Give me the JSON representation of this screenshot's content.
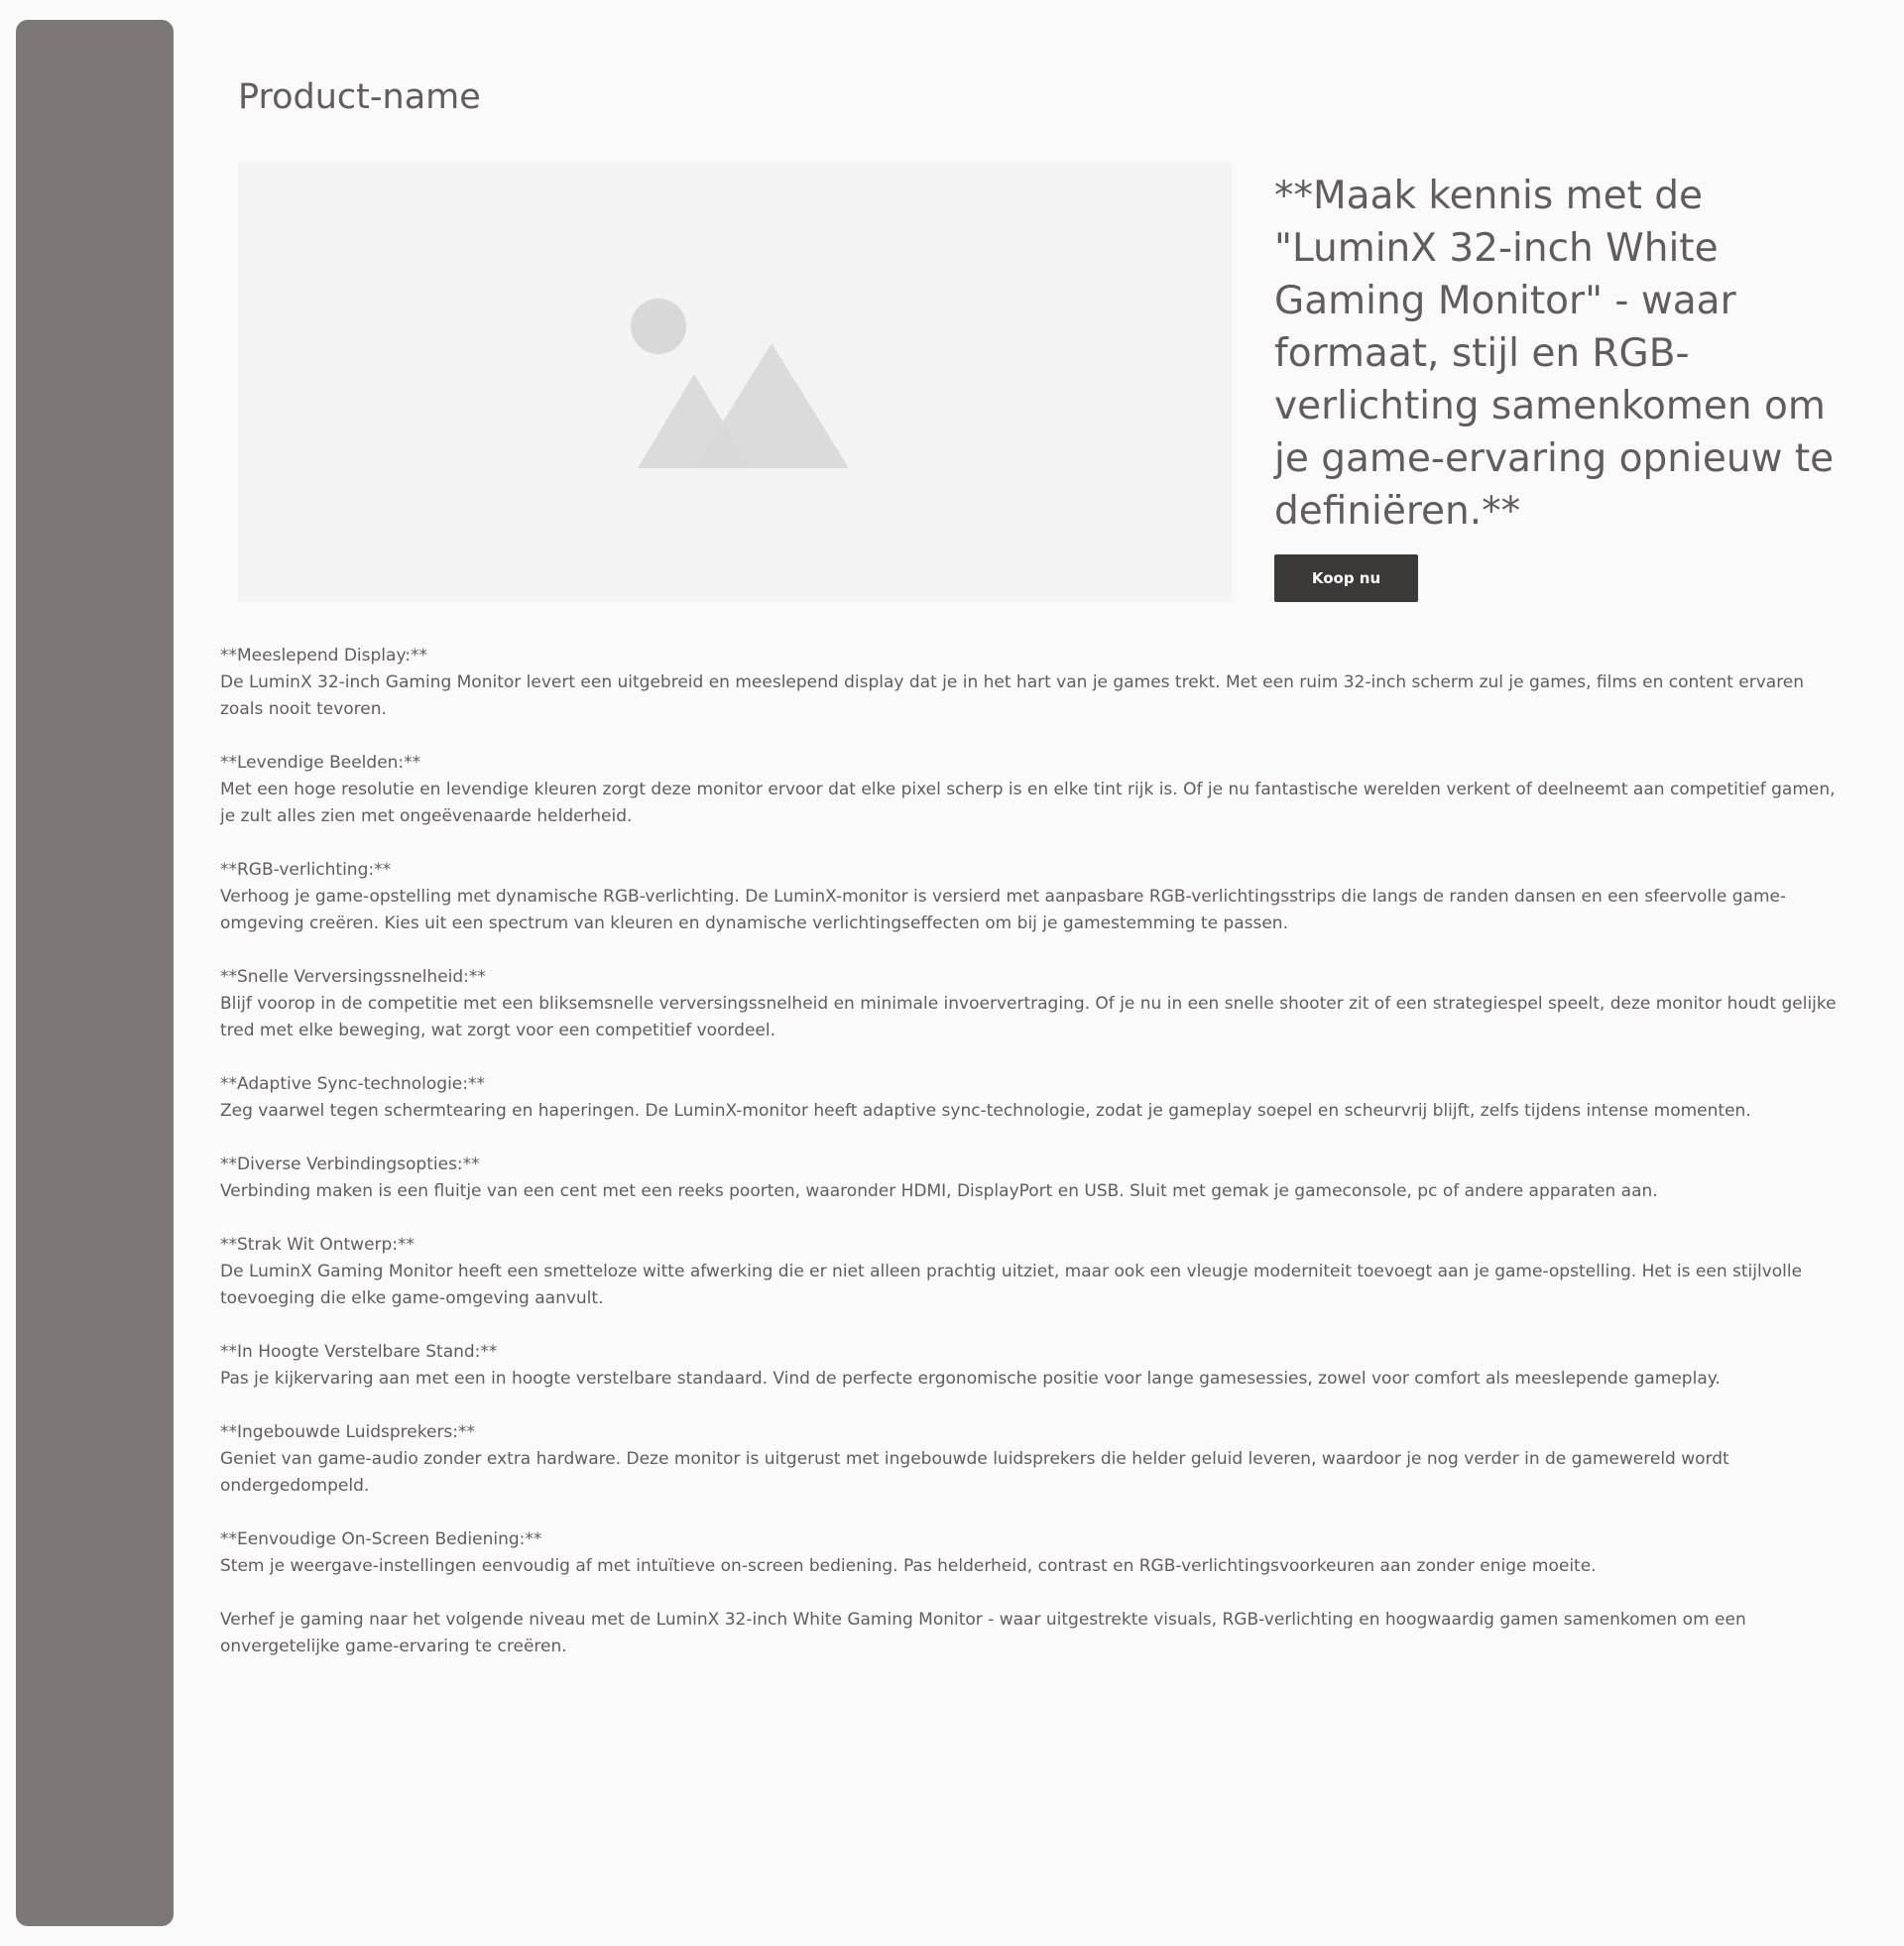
{
  "product": {
    "title": "Product-name",
    "tagline": "**Maak kennis met de \"LuminX 32-inch White Gaming Monitor\" - waar formaat, stijl en RGB-verlichting samenkomen om je game-ervaring opnieuw te definiëren.**",
    "buy_label": "Koop nu"
  },
  "features": [
    {
      "heading": "**Meeslepend Display:**",
      "body": "De LuminX 32-inch Gaming Monitor levert een uitgebreid en meeslepend display dat je in het hart van je games trekt. Met een ruim 32-inch scherm zul je games, films en content ervaren zoals nooit tevoren."
    },
    {
      "heading": "**Levendige Beelden:**",
      "body": "Met een hoge resolutie en levendige kleuren zorgt deze monitor ervoor dat elke pixel scherp is en elke tint rijk is. Of je nu fantastische werelden verkent of deelneemt aan competitief gamen, je zult alles zien met ongeëvenaarde helderheid."
    },
    {
      "heading": "**RGB-verlichting:**",
      "body": "Verhoog je game-opstelling met dynamische RGB-verlichting. De LuminX-monitor is versierd met aanpasbare RGB-verlichtingsstrips die langs de randen dansen en een sfeervolle game-omgeving creëren. Kies uit een spectrum van kleuren en dynamische verlichtingseffecten om bij je gamestemming te passen."
    },
    {
      "heading": "**Snelle Verversingssnelheid:**",
      "body": "Blijf voorop in de competitie met een bliksemsnelle verversingssnelheid en minimale invoervertraging. Of je nu in een snelle shooter zit of een strategiespel speelt, deze monitor houdt gelijke tred met elke beweging, wat zorgt voor een competitief voordeel."
    },
    {
      "heading": "**Adaptive Sync-technologie:**",
      "body": "Zeg vaarwel tegen schermtearing en haperingen. De LuminX-monitor heeft adaptive sync-technologie, zodat je gameplay soepel en scheurvrij blijft, zelfs tijdens intense momenten."
    },
    {
      "heading": "**Diverse Verbindingsopties:**",
      "body": "Verbinding maken is een fluitje van een cent met een reeks poorten, waaronder HDMI, DisplayPort en USB. Sluit met gemak je gameconsole, pc of andere apparaten aan."
    },
    {
      "heading": "**Strak Wit Ontwerp:**",
      "body": "De LuminX Gaming Monitor heeft een smetteloze witte afwerking die er niet alleen prachtig uitziet, maar ook een vleugje moderniteit toevoegt aan je game-opstelling. Het is een stijlvolle toevoeging die elke game-omgeving aanvult."
    },
    {
      "heading": "**In Hoogte Verstelbare Stand:**",
      "body": "Pas je kijkervaring aan met een in hoogte verstelbare standaard. Vind de perfecte ergonomische positie voor lange gamesessies, zowel voor comfort als meeslepende gameplay."
    },
    {
      "heading": "**Ingebouwde Luidsprekers:**",
      "body": "Geniet van game-audio zonder extra hardware. Deze monitor is uitgerust met ingebouwde luidsprekers die helder geluid leveren, waardoor je nog verder in de gamewereld wordt ondergedompeld."
    },
    {
      "heading": "**Eenvoudige On-Screen Bediening:**",
      "body": "Stem je weergave-instellingen eenvoudig af met intuïtieve on-screen bediening. Pas helderheid, contrast en RGB-verlichtingsvoorkeuren aan zonder enige moeite."
    }
  ],
  "closing": "Verhef je gaming naar het volgende niveau met de LuminX 32-inch White Gaming Monitor - waar uitgestrekte visuals, RGB-verlichting en hoogwaardig gamen samenkomen om een onvergetelijke game-ervaring te creëren.",
  "icons": {
    "image_placeholder": "image-placeholder-icon"
  },
  "colors": {
    "sidebar": "#7d7776",
    "background": "#fafafa",
    "image_bg": "#f3f3f3",
    "text": "#605e5c",
    "button_bg": "#3b3a39",
    "button_text": "#ffffff"
  }
}
